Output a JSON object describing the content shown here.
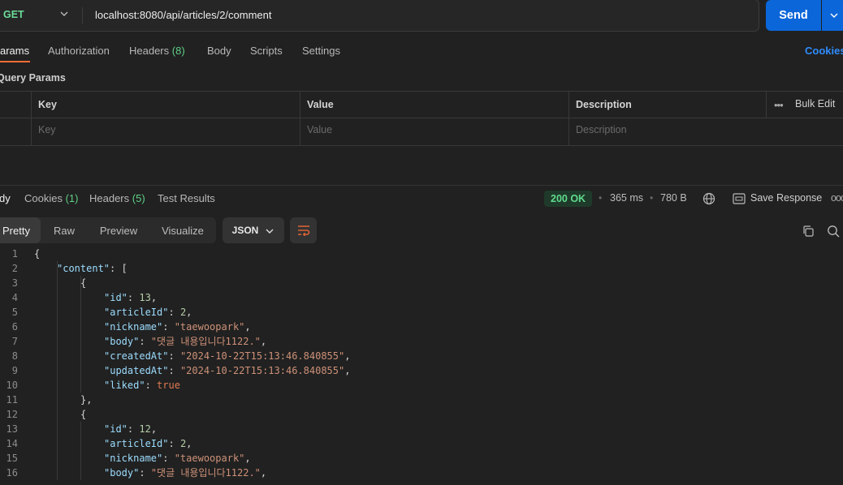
{
  "request": {
    "method": "GET",
    "url": "localhost:8080/api/articles/2/comment",
    "send_label": "Send"
  },
  "request_tabs": {
    "params": "arams",
    "authorization": "Authorization",
    "headers": "Headers",
    "headers_count": "(8)",
    "body": "Body",
    "scripts": "Scripts",
    "settings": "Settings",
    "cookies": "Cookies"
  },
  "query_params": {
    "title": "Query Params",
    "columns": {
      "key": "Key",
      "value": "Value",
      "description": "Description"
    },
    "bulk_edit": "Bulk Edit",
    "placeholders": {
      "key": "Key",
      "value": "Value",
      "description": "Description"
    }
  },
  "response_tabs": {
    "body": "dy",
    "cookies": "Cookies",
    "cookies_count": "(1)",
    "headers": "Headers",
    "headers_count": "(5)",
    "test_results": "Test Results"
  },
  "response_meta": {
    "status": "200 OK",
    "time": "365 ms",
    "size": "780 B",
    "save_response": "Save Response"
  },
  "body_toolbar": {
    "views": [
      "Pretty",
      "Raw",
      "Preview",
      "Visualize"
    ],
    "active_view": "Pretty",
    "format": "JSON"
  },
  "code_lines": [
    {
      "n": "1",
      "t": [
        [
          "p",
          "{"
        ]
      ]
    },
    {
      "n": "2",
      "t": [
        [
          "k",
          "\"content\""
        ],
        [
          "p",
          ": ["
        ]
      ]
    },
    {
      "n": "3",
      "t": [
        [
          "p",
          "{"
        ]
      ]
    },
    {
      "n": "4",
      "t": [
        [
          "k",
          "\"id\""
        ],
        [
          "p",
          ": "
        ],
        [
          "n",
          "13"
        ],
        [
          "p",
          ","
        ]
      ]
    },
    {
      "n": "5",
      "t": [
        [
          "k",
          "\"articleId\""
        ],
        [
          "p",
          ": "
        ],
        [
          "n",
          "2"
        ],
        [
          "p",
          ","
        ]
      ]
    },
    {
      "n": "6",
      "t": [
        [
          "k",
          "\"nickname\""
        ],
        [
          "p",
          ": "
        ],
        [
          "s",
          "\"taewoopark\""
        ],
        [
          "p",
          ","
        ]
      ]
    },
    {
      "n": "7",
      "t": [
        [
          "k",
          "\"body\""
        ],
        [
          "p",
          ": "
        ],
        [
          "s",
          "\"댓글 내용입니다1122.\""
        ],
        [
          "p",
          ","
        ]
      ]
    },
    {
      "n": "8",
      "t": [
        [
          "k",
          "\"createdAt\""
        ],
        [
          "p",
          ": "
        ],
        [
          "s",
          "\"2024-10-22T15:13:46.840855\""
        ],
        [
          "p",
          ","
        ]
      ]
    },
    {
      "n": "9",
      "t": [
        [
          "k",
          "\"updatedAt\""
        ],
        [
          "p",
          ": "
        ],
        [
          "s",
          "\"2024-10-22T15:13:46.840855\""
        ],
        [
          "p",
          ","
        ]
      ]
    },
    {
      "n": "10",
      "t": [
        [
          "k",
          "\"liked\""
        ],
        [
          "p",
          ": "
        ],
        [
          "b",
          "true"
        ]
      ]
    },
    {
      "n": "11",
      "t": [
        [
          "p",
          "},"
        ]
      ]
    },
    {
      "n": "12",
      "t": [
        [
          "p",
          "{"
        ]
      ]
    },
    {
      "n": "13",
      "t": [
        [
          "k",
          "\"id\""
        ],
        [
          "p",
          ": "
        ],
        [
          "n",
          "12"
        ],
        [
          "p",
          ","
        ]
      ]
    },
    {
      "n": "14",
      "t": [
        [
          "k",
          "\"articleId\""
        ],
        [
          "p",
          ": "
        ],
        [
          "n",
          "2"
        ],
        [
          "p",
          ","
        ]
      ]
    },
    {
      "n": "15",
      "t": [
        [
          "k",
          "\"nickname\""
        ],
        [
          "p",
          ": "
        ],
        [
          "s",
          "\"taewoopark\""
        ],
        [
          "p",
          ","
        ]
      ]
    },
    {
      "n": "16",
      "t": [
        [
          "k",
          "\"body\""
        ],
        [
          "p",
          ": "
        ],
        [
          "s",
          "\"댓글 내용입니다1122.\""
        ],
        [
          "p",
          ","
        ]
      ]
    }
  ],
  "colors": {
    "send": "#0b66d9",
    "method": "#6bdd9a",
    "status": "#5fdb8c",
    "active_tab_underline": "#ff6c37",
    "link": "#2f8cff"
  }
}
